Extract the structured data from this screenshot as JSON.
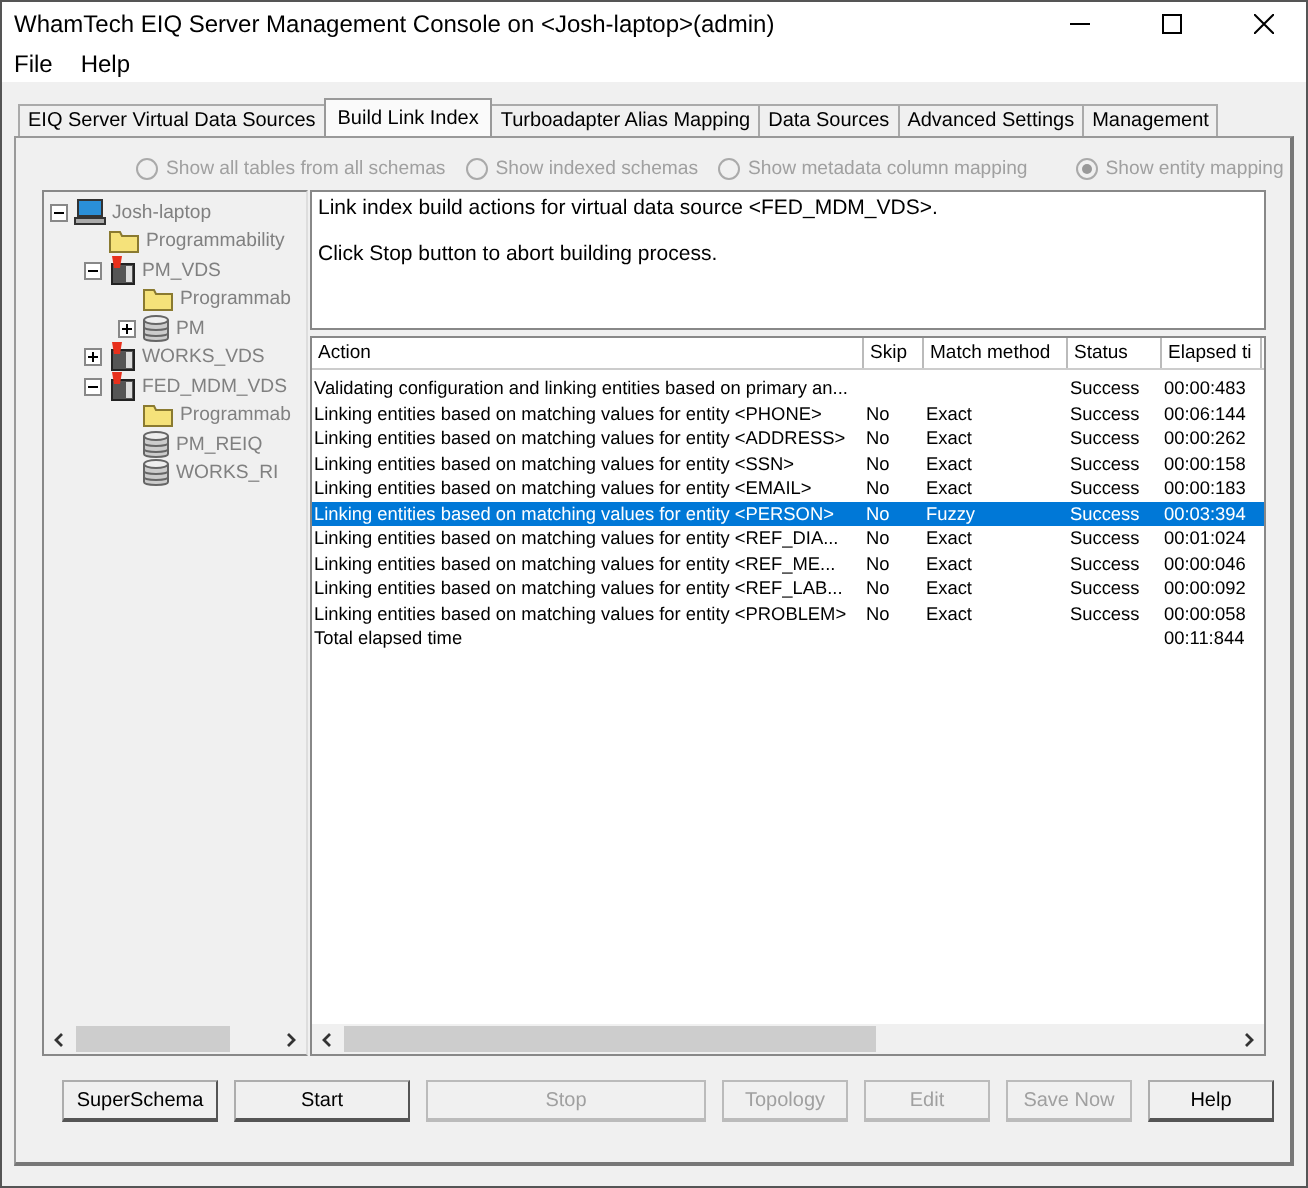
{
  "window": {
    "title": "WhamTech EIQ Server Management Console on <Josh-laptop>(admin)"
  },
  "menu": [
    "File",
    "Help"
  ],
  "tabs": [
    {
      "label": "EIQ Server Virtual Data Sources",
      "selected": false
    },
    {
      "label": "Build Link Index",
      "selected": true
    },
    {
      "label": "Turboadapter Alias Mapping",
      "selected": false
    },
    {
      "label": "Data Sources",
      "selected": false
    },
    {
      "label": "Advanced Settings",
      "selected": false
    },
    {
      "label": "Management",
      "selected": false
    }
  ],
  "view_options": [
    {
      "label": "Show all tables from all schemas",
      "selected": false,
      "disabled": true
    },
    {
      "label": "Show indexed schemas",
      "selected": false,
      "disabled": true
    },
    {
      "label": "Show metadata column mapping",
      "selected": false,
      "disabled": true
    },
    {
      "label": "Show entity mapping",
      "selected": true,
      "disabled": true
    }
  ],
  "tree": [
    {
      "label": "Josh-laptop",
      "kind": "computer",
      "expanded": true,
      "children": [
        {
          "label": "Programmability",
          "kind": "folder"
        },
        {
          "label": "PM_VDS",
          "kind": "vds",
          "expanded": true,
          "children": [
            {
              "label": "Programmab",
              "kind": "folder"
            },
            {
              "label": "PM",
              "kind": "database",
              "expanded": false
            }
          ]
        },
        {
          "label": "WORKS_VDS",
          "kind": "vds",
          "expanded": false
        },
        {
          "label": "FED_MDM_VDS",
          "kind": "vds",
          "expanded": true,
          "children": [
            {
              "label": "Programmab",
              "kind": "folder"
            },
            {
              "label": "PM_REIQ",
              "kind": "database"
            },
            {
              "label": "WORKS_RI",
              "kind": "database"
            }
          ]
        }
      ]
    }
  ],
  "message": [
    "Link index build actions for virtual data source <FED_MDM_VDS>.",
    "Click Stop button to abort building process."
  ],
  "table": {
    "columns": [
      "Action",
      "Skip",
      "Match method",
      "Status",
      "Elapsed ti"
    ],
    "rows": [
      {
        "cells": [
          "Validating configuration and linking entities based on primary an...",
          "",
          "",
          "Success",
          "00:00:483"
        ],
        "selected": false
      },
      {
        "cells": [
          "Linking entities based on matching values for entity <PHONE>",
          "No",
          "Exact",
          "Success",
          "00:06:144"
        ],
        "selected": false
      },
      {
        "cells": [
          "Linking entities based on matching values for entity <ADDRESS>",
          "No",
          "Exact",
          "Success",
          "00:00:262"
        ],
        "selected": false
      },
      {
        "cells": [
          "Linking entities based on matching values for entity <SSN>",
          "No",
          "Exact",
          "Success",
          "00:00:158"
        ],
        "selected": false
      },
      {
        "cells": [
          "Linking entities based on matching values for entity <EMAIL>",
          "No",
          "Exact",
          "Success",
          "00:00:183"
        ],
        "selected": false
      },
      {
        "cells": [
          "Linking entities based on matching values for entity <PERSON>",
          "No",
          "Fuzzy",
          "Success",
          "00:03:394"
        ],
        "selected": true
      },
      {
        "cells": [
          "Linking entities based on matching values for entity <REF_DIA...",
          "No",
          "Exact",
          "Success",
          "00:01:024"
        ],
        "selected": false
      },
      {
        "cells": [
          "Linking entities based on matching values for entity <REF_ME...",
          "No",
          "Exact",
          "Success",
          "00:00:046"
        ],
        "selected": false
      },
      {
        "cells": [
          "Linking entities based on matching values for entity <REF_LAB...",
          "No",
          "Exact",
          "Success",
          "00:00:092"
        ],
        "selected": false
      },
      {
        "cells": [
          "Linking entities based on matching values for entity <PROBLEM>",
          "No",
          "Exact",
          "Success",
          "00:00:058"
        ],
        "selected": false
      },
      {
        "cells": [
          "Total elapsed time",
          "",
          "",
          "",
          "00:11:844"
        ],
        "selected": false
      }
    ]
  },
  "buttons": [
    {
      "label": "SuperSchema",
      "disabled": false
    },
    {
      "label": "Start",
      "disabled": false
    },
    {
      "label": "Stop",
      "disabled": true
    },
    {
      "label": "Topology",
      "disabled": true
    },
    {
      "label": "Edit",
      "disabled": true
    },
    {
      "label": "Save Now",
      "disabled": true
    },
    {
      "label": "Help",
      "disabled": false
    }
  ]
}
